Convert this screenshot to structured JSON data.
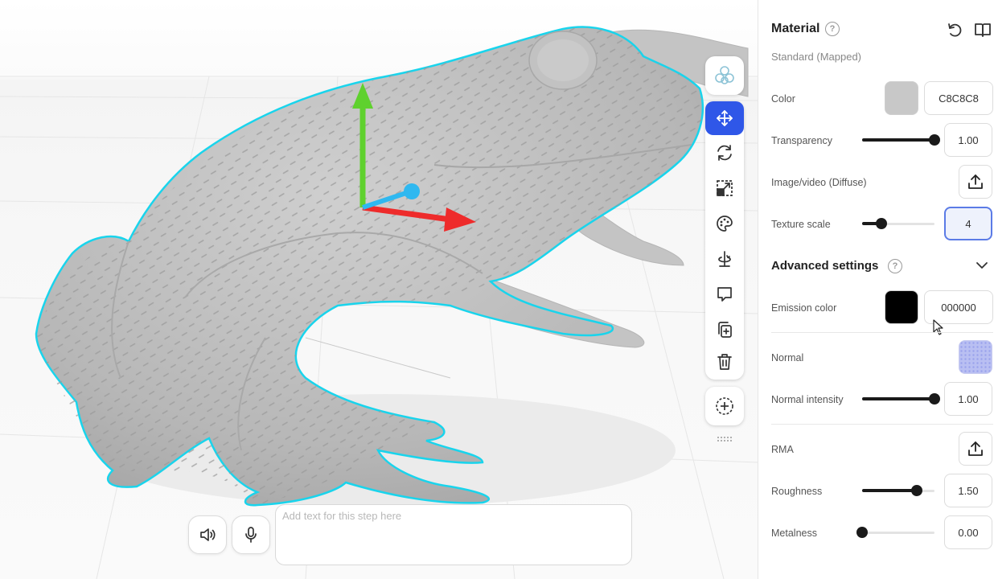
{
  "material": {
    "title": "Material",
    "help": "?",
    "type": "Standard (Mapped)",
    "color": {
      "label": "Color",
      "value": "C8C8C8",
      "swatch": "#c8c8c8"
    },
    "transparency": {
      "label": "Transparency",
      "value": "1.00",
      "fraction": 1.0
    },
    "diffuse": {
      "label": "Image/video (Diffuse)"
    },
    "texture_scale": {
      "label": "Texture scale",
      "value": "4",
      "fraction": 0.27
    }
  },
  "advanced": {
    "title": "Advanced settings",
    "help": "?",
    "emission": {
      "label": "Emission color",
      "value": "000000",
      "swatch": "#000000"
    },
    "normal": {
      "label": "Normal"
    },
    "normal_intensity": {
      "label": "Normal intensity",
      "value": "1.00",
      "fraction": 1.0
    },
    "rma": {
      "label": "RMA"
    },
    "roughness": {
      "label": "Roughness",
      "value": "1.50",
      "fraction": 0.75
    },
    "metalness": {
      "label": "Metalness",
      "value": "0.00",
      "fraction": 0.0
    }
  },
  "step": {
    "placeholder": "Add text for this step here"
  },
  "toolbar": {
    "tools": [
      "move-tool",
      "rotate-tool",
      "scale-tool",
      "material-tool",
      "pivot-tool",
      "comment-tool",
      "duplicate-tool",
      "delete-tool"
    ],
    "active_tool": "move-tool"
  },
  "colors": {
    "accent": "#2f57e8",
    "selection_outline": "#19d4ec",
    "gizmo_x": "#ee2b2b",
    "gizmo_y": "#5fd12e",
    "gizmo_z": "#2fb8f0"
  }
}
